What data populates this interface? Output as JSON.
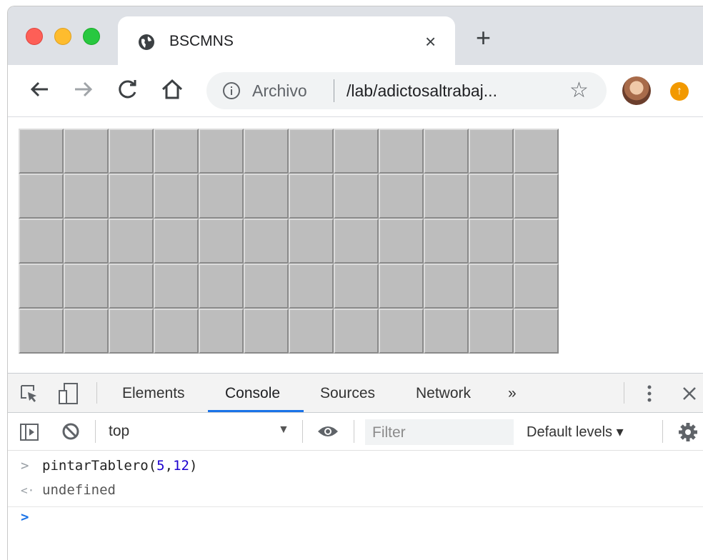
{
  "tab": {
    "title": "BSCMNS",
    "close": "×"
  },
  "new_tab": "+",
  "omnibox": {
    "scheme_label": "Archivo",
    "url": "/lab/adictosaltrabaj..."
  },
  "board": {
    "rows": 5,
    "cols": 12
  },
  "devtools": {
    "tabs": [
      "Elements",
      "Console",
      "Sources",
      "Network"
    ],
    "active_tab": "Console",
    "more": "»",
    "context": "top",
    "filter_placeholder": "Filter",
    "levels": "Default levels ▾"
  },
  "console": {
    "input_fn": "pintarTablero(",
    "input_arg1": "5",
    "input_comma": ",",
    "input_arg2": "12",
    "input_close": ")",
    "result": "undefined"
  },
  "colors": {
    "accent": "#1a73e8",
    "cell": "#bdbdbd"
  }
}
